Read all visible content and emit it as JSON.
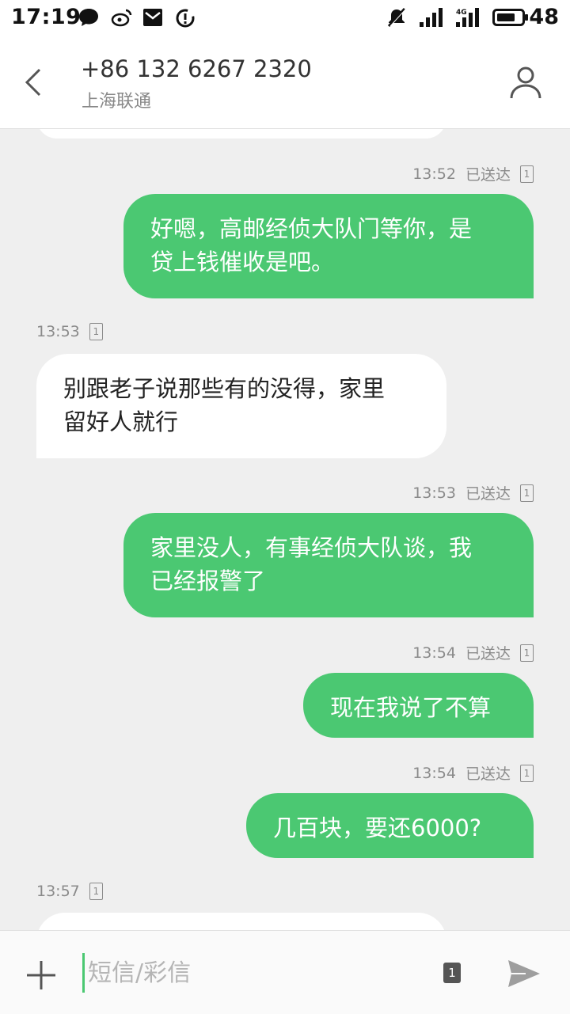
{
  "status_bar": {
    "time": "17:19",
    "network_type": "4G",
    "battery_level": "48",
    "icons": [
      "chat-bubble-icon",
      "weibo-icon",
      "mail-icon",
      "sync-icon",
      "mute-icon",
      "signal-icon",
      "signal-4g-icon",
      "battery-icon"
    ]
  },
  "header": {
    "contact_number": "+86 132 6267 2320",
    "carrier": "上海联通",
    "back_icon": "chevron-left-icon",
    "contact_icon": "person-icon"
  },
  "messages": [
    {
      "direction": "out",
      "time": "13:52",
      "status": "已送达",
      "sim": "1",
      "text": "好嗯，高邮经侦大队门等你，是\n贷上钱催收是吧。"
    },
    {
      "direction": "in",
      "time": "13:53",
      "sim": "1",
      "text": "别跟老子说那些有的没得，家里\n留好人就行"
    },
    {
      "direction": "out",
      "time": "13:53",
      "status": "已送达",
      "sim": "1",
      "text": "家里没人，有事经侦大队谈，我\n已经报警了"
    },
    {
      "direction": "out",
      "time": "13:54",
      "status": "已送达",
      "sim": "1",
      "text": "现在我说了不算"
    },
    {
      "direction": "out",
      "time": "13:54",
      "status": "已送达",
      "sim": "1",
      "text": "几百块，要还6000?"
    },
    {
      "direction": "in",
      "time": "13:57",
      "sim": "1",
      "text": ""
    }
  ],
  "composer": {
    "placeholder": "短信/彩信",
    "value": "",
    "sim_label": "1",
    "add_icon": "plus-icon",
    "send_icon": "send-icon"
  },
  "colors": {
    "outgoing_bubble": "#4bc872",
    "incoming_bubble": "#ffffff",
    "background": "#efefef"
  }
}
